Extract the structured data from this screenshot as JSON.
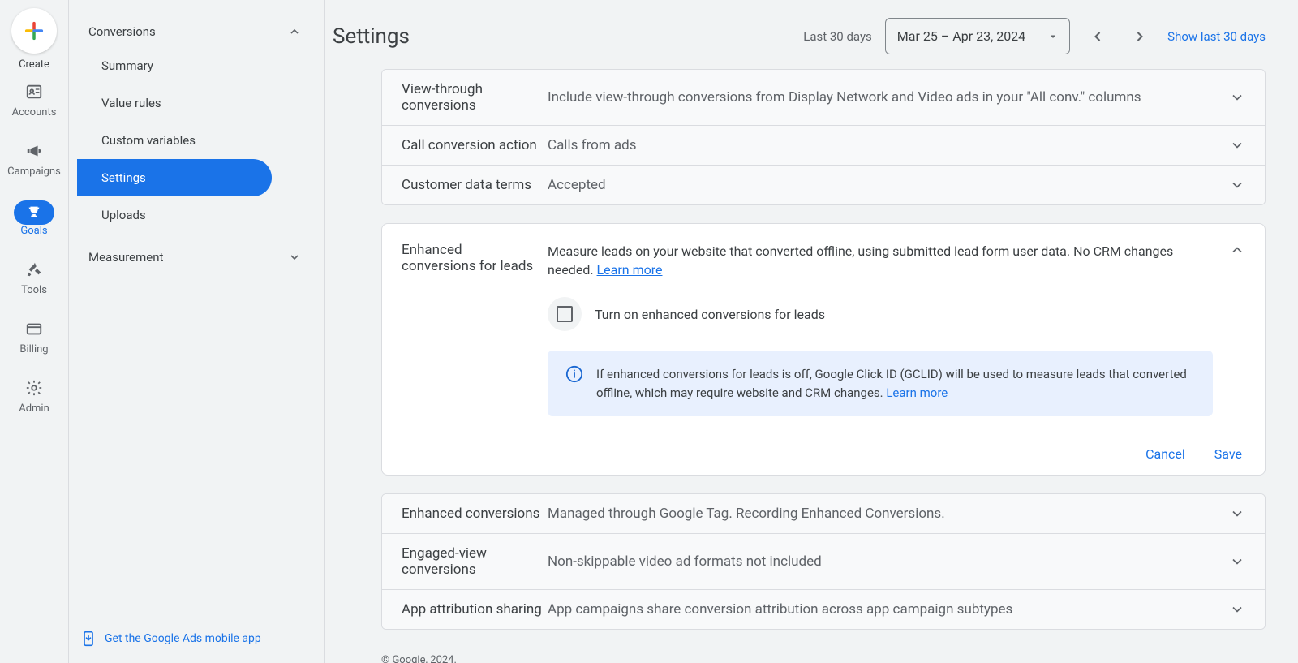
{
  "rail": {
    "create": "Create",
    "items": [
      {
        "label": "Accounts",
        "icon": "accounts"
      },
      {
        "label": "Campaigns",
        "icon": "campaigns"
      },
      {
        "label": "Goals",
        "icon": "goals",
        "active": true
      },
      {
        "label": "Tools",
        "icon": "tools"
      },
      {
        "label": "Billing",
        "icon": "billing"
      },
      {
        "label": "Admin",
        "icon": "admin"
      }
    ]
  },
  "sidebar": {
    "section1_label": "Conversions",
    "items": [
      "Summary",
      "Value rules",
      "Custom variables",
      "Settings",
      "Uploads"
    ],
    "active_index": 3,
    "section2_label": "Measurement",
    "mobile_app_text": "Get the Google Ads mobile app"
  },
  "header": {
    "title": "Settings",
    "last_label": "Last 30 days",
    "date_range": "Mar 25 – Apr 23, 2024",
    "show_last": "Show last 30 days"
  },
  "accordions_top": [
    {
      "label": "View-through conversions",
      "value": "Include view-through conversions from Display Network and Video ads in your \"All conv.\" columns"
    },
    {
      "label": "Call conversion action",
      "value": "Calls from ads"
    },
    {
      "label": "Customer data terms",
      "value": "Accepted"
    }
  ],
  "card": {
    "title": "Enhanced conversions for leads",
    "desc_a": "Measure leads on your website that converted offline, using ",
    "desc_link": "submitted lead form user data",
    "desc_b": ". No CRM changes needed. ",
    "learn_more": "Learn more",
    "checkbox_label": "Turn on enhanced conversions for leads",
    "info_text": "If enhanced conversions for leads is off, Google Click ID (GCLID) will be used to measure leads that converted offline, which may require website and CRM changes. ",
    "info_learn": "Learn more",
    "cancel": "Cancel",
    "save": "Save"
  },
  "accordions_bottom": [
    {
      "label": "Enhanced conversions",
      "value": "Managed through Google Tag. Recording Enhanced Conversions."
    },
    {
      "label": "Engaged-view conversions",
      "value": "Non-skippable video ad formats not included"
    },
    {
      "label": "App attribution sharing",
      "value": "App campaigns share conversion attribution across app campaign subtypes"
    }
  ],
  "footer": "© Google, 2024."
}
